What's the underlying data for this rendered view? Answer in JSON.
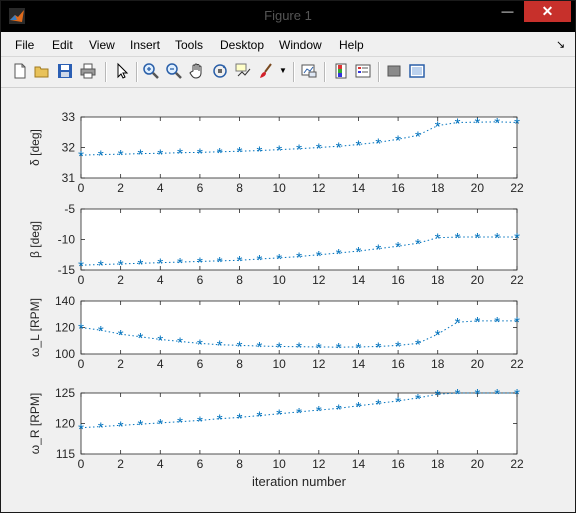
{
  "window": {
    "title": "Figure 1",
    "close_glyph": "✕",
    "min_glyph": "—",
    "max_glyph": "☐"
  },
  "menu": {
    "items": [
      "File",
      "Edit",
      "View",
      "Insert",
      "Tools",
      "Desktop",
      "Window",
      "Help"
    ],
    "dock_glyph": "↘"
  },
  "toolbar": {
    "icons": [
      "new-figure-icon",
      "open-file-icon",
      "save-icon",
      "print-icon",
      "pointer-icon",
      "zoom-in-icon",
      "zoom-out-icon",
      "pan-hand-icon",
      "rotate-3d-icon",
      "data-cursor-icon",
      "brush-icon",
      "brush-dropdown-icon",
      "link-plot-icon",
      "colorbar-icon",
      "legend-icon",
      "hide-plot-tools-icon",
      "show-plot-tools-icon"
    ]
  },
  "colors": {
    "series": "#0072bd",
    "axes_bg": "#ffffff",
    "axis_line": "#262626"
  },
  "chart_data": [
    {
      "type": "line",
      "ylabel": "δ [deg]",
      "xlim": [
        0,
        22
      ],
      "ylim": [
        31,
        33
      ],
      "xticks": [
        "0",
        "2",
        "4",
        "6",
        "8",
        "10",
        "12",
        "14",
        "16",
        "18",
        "20",
        "22"
      ],
      "yticks": [
        "31",
        "32",
        "33"
      ],
      "x": [
        0,
        1,
        2,
        3,
        4,
        5,
        6,
        7,
        8,
        9,
        10,
        11,
        12,
        13,
        14,
        15,
        16,
        17,
        18,
        19,
        20,
        21,
        22
      ],
      "values": [
        31.75,
        31.77,
        31.78,
        31.8,
        31.81,
        31.83,
        31.84,
        31.86,
        31.88,
        31.9,
        31.93,
        31.96,
        32.0,
        32.04,
        32.1,
        32.17,
        32.27,
        32.4,
        32.72,
        32.82,
        32.83,
        32.84,
        32.82
      ],
      "marker": "*",
      "linestyle": "dotted"
    },
    {
      "type": "line",
      "ylabel": "β [deg]",
      "xlim": [
        0,
        22
      ],
      "ylim": [
        -15,
        -5
      ],
      "xticks": [],
      "yticks": [
        "-15",
        "-10",
        "-5"
      ],
      "x": [
        0,
        1,
        2,
        3,
        4,
        5,
        6,
        7,
        8,
        9,
        10,
        11,
        12,
        13,
        14,
        15,
        16,
        17,
        18,
        19,
        20,
        21,
        22
      ],
      "values": [
        -14.2,
        -14.1,
        -14.0,
        -13.9,
        -13.8,
        -13.7,
        -13.6,
        -13.5,
        -13.4,
        -13.2,
        -13.0,
        -12.8,
        -12.5,
        -12.2,
        -11.9,
        -11.5,
        -11.1,
        -10.6,
        -9.7,
        -9.6,
        -9.6,
        -9.6,
        -9.6
      ],
      "marker": "*",
      "linestyle": "dotted"
    },
    {
      "type": "line",
      "ylabel": "ω_L [RPM]",
      "xlim": [
        0,
        22
      ],
      "ylim": [
        100,
        140
      ],
      "xticks": [],
      "yticks": [
        "100",
        "120",
        "140"
      ],
      "x": [
        0,
        1,
        2,
        3,
        4,
        5,
        6,
        7,
        8,
        9,
        10,
        11,
        12,
        13,
        14,
        15,
        16,
        17,
        18,
        19,
        20,
        21,
        22
      ],
      "values": [
        120,
        118,
        115,
        113,
        111,
        109.5,
        108,
        107,
        106.5,
        106,
        105.7,
        105.5,
        105.3,
        105.2,
        105.3,
        105.7,
        106.5,
        108,
        115,
        124,
        125,
        125,
        125
      ],
      "marker": "*",
      "linestyle": "dotted"
    },
    {
      "type": "line",
      "ylabel": "ω_R [RPM]",
      "xlabel": "iteration number",
      "xlim": [
        0,
        22
      ],
      "ylim": [
        115,
        125
      ],
      "xticks": [
        "0",
        "2",
        "4",
        "6",
        "8",
        "10",
        "12",
        "14",
        "16",
        "18",
        "20",
        "22"
      ],
      "yticks": [
        "115",
        "120",
        "125"
      ],
      "x": [
        0,
        1,
        2,
        3,
        4,
        5,
        6,
        7,
        8,
        9,
        10,
        11,
        12,
        13,
        14,
        15,
        16,
        17,
        18,
        19,
        20,
        21,
        22
      ],
      "values": [
        119.3,
        119.5,
        119.7,
        119.9,
        120.1,
        120.3,
        120.5,
        120.8,
        121.0,
        121.3,
        121.6,
        121.9,
        122.2,
        122.5,
        122.9,
        123.3,
        123.7,
        124.2,
        124.8,
        125,
        125,
        125,
        125
      ],
      "marker": "*",
      "linestyle": "dotted"
    }
  ]
}
